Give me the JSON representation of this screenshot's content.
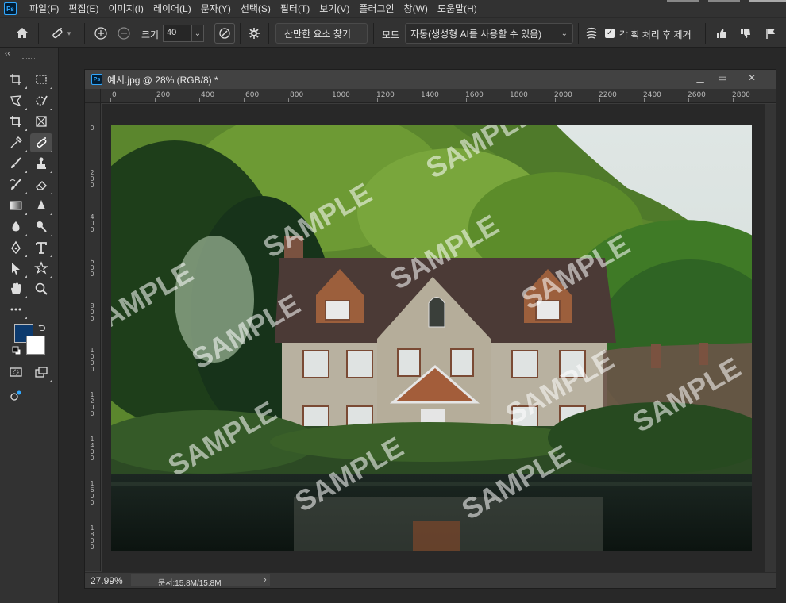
{
  "app": {
    "logo": "Ps"
  },
  "menu": [
    "파일(F)",
    "편집(E)",
    "이미지(I)",
    "레이어(L)",
    "문자(Y)",
    "선택(S)",
    "필터(T)",
    "보기(V)",
    "플러그인",
    "창(W)",
    "도움말(H)"
  ],
  "options": {
    "size_label": "크기",
    "size_value": "40",
    "distraction_button": "산만한 요소 찾기",
    "mode_label": "모드",
    "mode_value": "자동(생성형 AI를 사용할 수 있음)",
    "sample_all_layers": "각 획 처리 후 제거"
  },
  "document": {
    "title": "예시.jpg @ 28% (RGB/8) *",
    "zoom": "27.99%",
    "doc_info": "문서:15.8M/15.8M",
    "ruler_h": [
      "0",
      "200",
      "400",
      "600",
      "800",
      "1000",
      "1200",
      "1400",
      "1600",
      "1800",
      "2000",
      "2200",
      "2400",
      "2600",
      "2800"
    ],
    "ruler_v": [
      "0",
      "200",
      "400",
      "600",
      "800",
      "1000",
      "1200",
      "1400",
      "1600",
      "1800"
    ],
    "watermark": "SAMPLE"
  },
  "colors": {
    "foreground": "#0c3a6e",
    "background": "#ffffff",
    "accent": "#31a8ff"
  },
  "icons": [
    "home-icon",
    "spot-healing-brush-icon",
    "brush-add-icon",
    "brush-subtract-icon",
    "pressure-icon",
    "settings-icon",
    "gear-icon",
    "checkbox-icon",
    "thumbs-up-icon",
    "thumbs-down-icon",
    "flag-icon"
  ]
}
